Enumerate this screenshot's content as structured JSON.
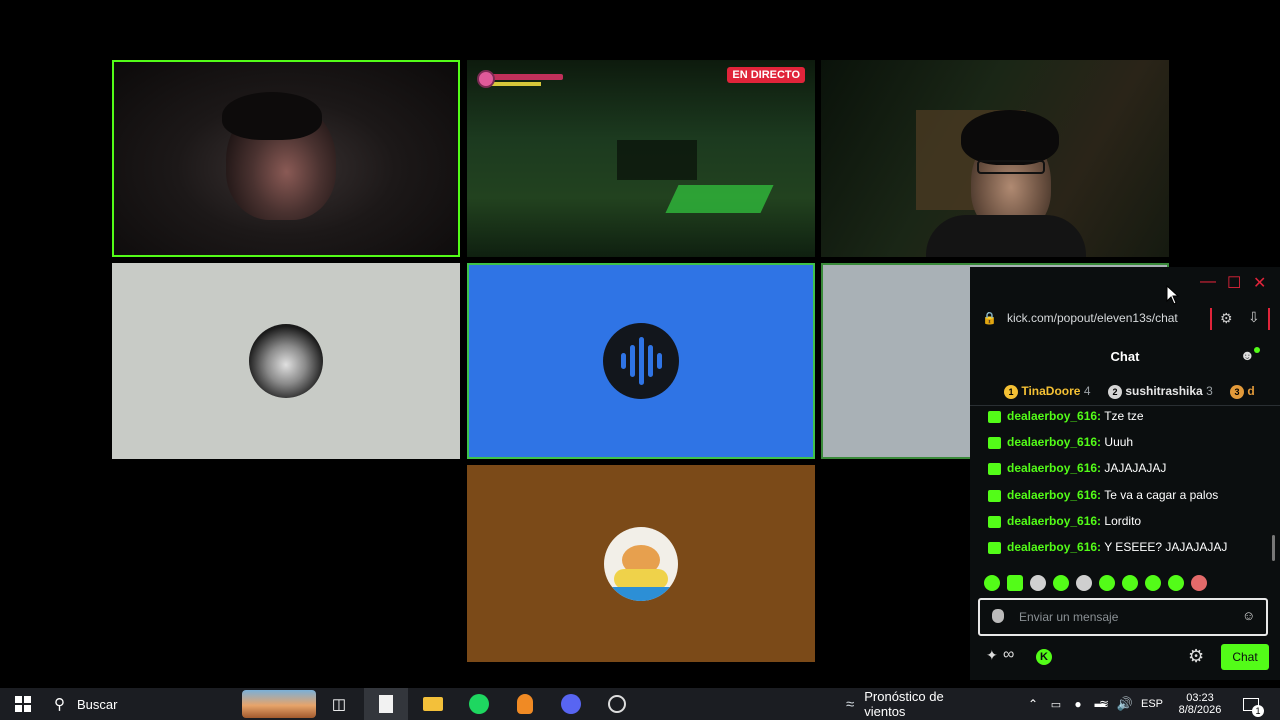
{
  "stream": {
    "live_badge": "EN DIRECTO"
  },
  "chat_window": {
    "url": "kick.com/popout/eleven13s/chat",
    "title": "Chat",
    "leaderboard": [
      {
        "rank": "1",
        "name": "TinaDoore",
        "count": "4",
        "color": "#f4c034"
      },
      {
        "rank": "2",
        "name": "sushitrashika",
        "count": "3",
        "color": "#d5d5d5"
      },
      {
        "rank": "3",
        "name": "d",
        "count": "",
        "color": "#e39a3a"
      }
    ],
    "messages": [
      {
        "user": "dealaerboy_616:",
        "text": "Tze tze"
      },
      {
        "user": "dealaerboy_616:",
        "text": "Uuuh"
      },
      {
        "user": "dealaerboy_616:",
        "text": "JAJAJAJAJ"
      },
      {
        "user": "dealaerboy_616:",
        "text": "Te va a cagar a palos"
      },
      {
        "user": "dealaerboy_616:",
        "text": "Lordito"
      },
      {
        "user": "dealaerboy_616:",
        "text": "Y ESEEE? JAJAJAJAJ"
      }
    ],
    "input_placeholder": "Enviar un mensaje",
    "send_label": "Chat",
    "accent": "#53fc18"
  },
  "taskbar": {
    "search_label": "Buscar",
    "weather_label": "Pronóstico de vientos",
    "language": "ESP",
    "time": "03:23",
    "date": "8/8/2026",
    "notification_count": "1"
  }
}
